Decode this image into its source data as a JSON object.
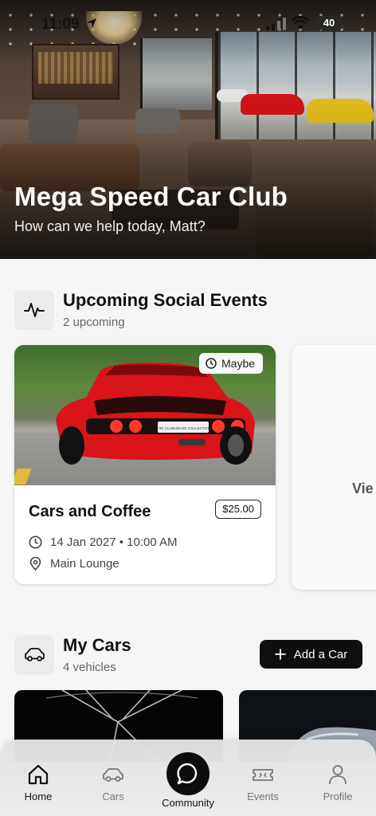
{
  "status_bar": {
    "time": "11:09",
    "battery": "40"
  },
  "hero": {
    "title": "Mega Speed Car Club",
    "subtitle": "How can we help today, Matt?"
  },
  "events_section": {
    "title": "Upcoming Social Events",
    "subtitle": "2 upcoming",
    "icon": "activity-icon"
  },
  "event_card": {
    "rsvp_badge": "Maybe",
    "title": "Cars and Coffee",
    "price": "$25.00",
    "datetime": "14 Jan 2027 • 10:00 AM",
    "location": "Main Lounge",
    "plate_text": "THE CLUBHOUSE COLLECTIVE"
  },
  "view_all_card": {
    "label": "Vie"
  },
  "cars_section": {
    "title": "My Cars",
    "subtitle": "4 vehicles",
    "icon": "car-icon",
    "add_button": "Add a Car"
  },
  "tabbar": {
    "home": "Home",
    "cars": "Cars",
    "community": "Community",
    "events": "Events",
    "profile": "Profile",
    "active": "Home"
  },
  "colors": {
    "accent": "#0f0f0f",
    "background": "#f6f6f6",
    "card": "#ffffff",
    "car_red": "#d9141b"
  }
}
